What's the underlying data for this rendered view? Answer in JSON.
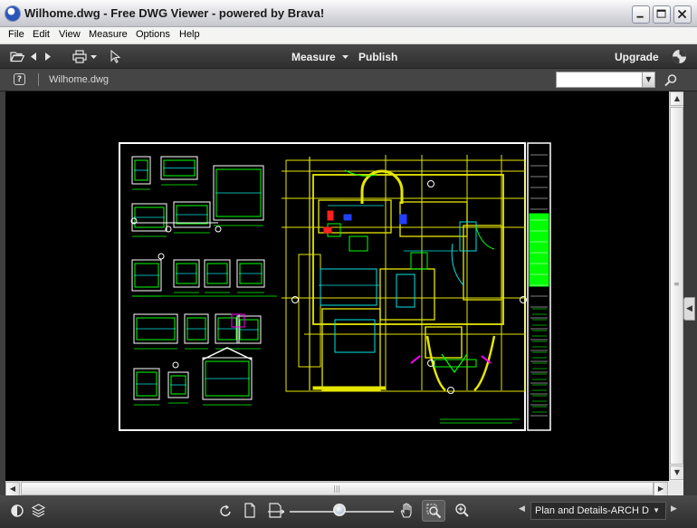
{
  "window": {
    "title": "Wilhome.dwg - Free DWG Viewer - powered by Brava!"
  },
  "menu": [
    "File",
    "Edit",
    "View",
    "Measure",
    "Options",
    "Help"
  ],
  "toolbar": {
    "measure_label": "Measure",
    "publish_label": "Publish",
    "upgrade_label": "Upgrade"
  },
  "docbar": {
    "help_glyph": "?",
    "filename": "Wilhome.dwg",
    "search_value": ""
  },
  "bottombar": {
    "layout_selected": "Plan and Details-ARCH D"
  },
  "colors": {
    "canvas": "#000000",
    "cad_white": "#ffffff",
    "cad_yellow": "#e6e600",
    "cad_green": "#00ff00",
    "cad_cyan": "#00e5e5",
    "cad_magenta": "#ff00ff",
    "cad_red": "#ff2020",
    "cad_blue": "#2040ff"
  },
  "icons": [
    "open-folder-icon",
    "back-icon",
    "forward-icon",
    "print-icon",
    "select-arrow-icon",
    "brava-logo-icon",
    "help-icon",
    "search-icon",
    "contrast-icon",
    "layers-icon",
    "rotate-icon",
    "page-icon",
    "fit-width-icon",
    "pan-hand-icon",
    "zoom-window-icon",
    "zoom-in-icon"
  ]
}
